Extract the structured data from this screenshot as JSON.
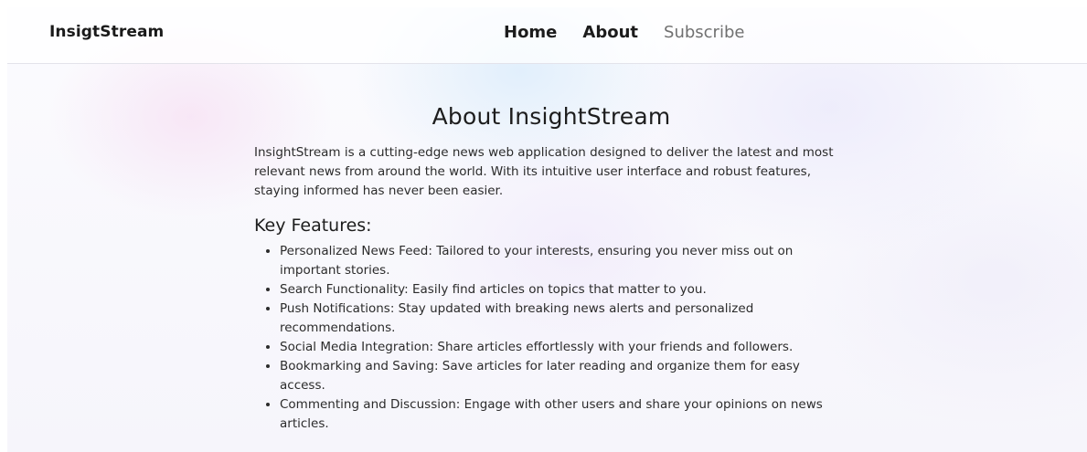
{
  "navbar": {
    "brand": "InsigtStream",
    "links": [
      {
        "label": "Home"
      },
      {
        "label": "About"
      },
      {
        "label": "Subscribe"
      }
    ]
  },
  "main": {
    "title": "About InsightStream",
    "intro": "InsightStream is a cutting-edge news web application designed to deliver the latest and most relevant news from around the world. With its intuitive user interface and robust features, staying informed has never been easier.",
    "features_heading": "Key Features:",
    "features": [
      "Personalized News Feed: Tailored to your interests, ensuring you never miss out on important stories.",
      "Search Functionality: Easily find articles on topics that matter to you.",
      "Push Notifications: Stay updated with breaking news alerts and personalized recommendations.",
      "Social Media Integration: Share articles effortlessly with your friends and followers.",
      "Bookmarking and Saving: Save articles for later reading and organize them for easy access.",
      "Commenting and Discussion: Engage with other users and share your opinions on news articles."
    ]
  }
}
